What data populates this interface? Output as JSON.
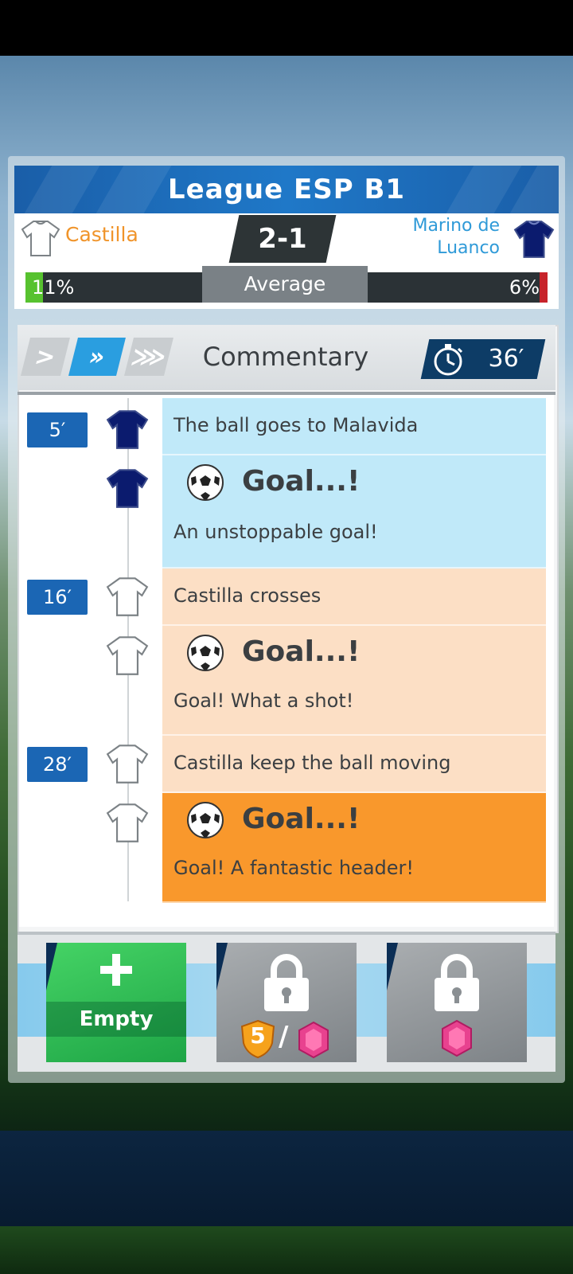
{
  "header": {
    "league_title": "League ESP B1"
  },
  "match": {
    "home": {
      "name": "Castilla",
      "shirt_color": "#ffffff"
    },
    "away": {
      "name_line1": "Marino de",
      "name_line2": "Luanco",
      "shirt_color": "#0b1b6e"
    },
    "score": "2-1"
  },
  "possession": {
    "home": "11%",
    "label": "Average",
    "away": "6%",
    "home_value": 0.11,
    "away_value": 0.06
  },
  "commentary": {
    "title": "Commentary",
    "speeds": [
      ">",
      "»",
      "⋙"
    ],
    "active_speed_index": 1,
    "clock": "36′"
  },
  "events": [
    {
      "minute": "5′",
      "team": "away",
      "text": "The ball goes to Malavida"
    },
    {
      "team": "away",
      "goal_title": "Goal...!",
      "text": "An unstoppable goal!"
    },
    {
      "minute": "16′",
      "team": "home",
      "text": "Castilla crosses"
    },
    {
      "team": "home",
      "goal_title": "Goal...!",
      "text": "Goal! What a shot!"
    },
    {
      "minute": "28′",
      "team": "home",
      "text": "Castilla keep the ball moving"
    },
    {
      "team": "home",
      "goal_title": "Goal...!",
      "text": "Goal! A fantastic header!"
    }
  ],
  "slots": {
    "add": {
      "label": "Empty"
    },
    "locked1": {
      "level": "5",
      "separator": "/"
    },
    "locked2": {}
  },
  "colors": {
    "accent_blue": "#1b66b4",
    "goal_orange": "#f9982c",
    "home_orange": "#f0942a",
    "away_blue": "#2f9ad8"
  }
}
